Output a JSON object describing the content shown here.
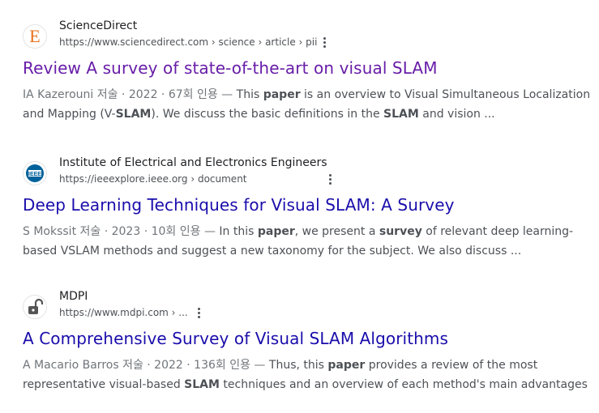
{
  "results": [
    {
      "site_name": "ScienceDirect",
      "url": "https://www.sciencedirect.com › science › article › pii",
      "favicon": "elsevier-e-icon",
      "title": "Review A survey of state-of-the-art on visual SLAM",
      "title_color": "#681da8",
      "snippet_meta": "IA Kazerouni 저술 · 2022 · 67회 인용 — ",
      "snippet_parts": {
        "p1": "This ",
        "b1": "paper",
        "p2": " is an overview to Visual Simultaneous Localization",
        "p3": "and Mapping (V-",
        "b2": "SLAM",
        "p4": "). We discuss the basic definitions in the ",
        "b3": "SLAM",
        "p5": " and vision ..."
      }
    },
    {
      "site_name": "Institute of Electrical and Electronics Engineers",
      "url": "https://ieeexplore.ieee.org › document",
      "favicon": "ieee-icon",
      "title": "Deep Learning Techniques for Visual SLAM: A Survey",
      "title_color": "#1a0dab",
      "snippet_meta": "S Mokssit 저술 · 2023 · 10회 인용 — ",
      "snippet_parts": {
        "p1": "In this ",
        "b1": "paper",
        "p2": ", we present a ",
        "b2": "survey",
        "p3": " of relevant deep learning-",
        "p4": "based VSLAM methods and suggest a new taxonomy for the subject. We also discuss ..."
      }
    },
    {
      "site_name": "MDPI",
      "url": "https://www.mdpi.com › ...",
      "favicon": "open-access-lock-icon",
      "title": "A Comprehensive Survey of Visual SLAM Algorithms",
      "title_color": "#1a0dab",
      "snippet_meta": "A Macario Barros 저술 · 2022 · 136회 인용 — ",
      "snippet_parts": {
        "p1": "Thus, this ",
        "b1": "paper",
        "p2": " provides a review of the most",
        "p3": "representative visual-based ",
        "b2": "SLAM",
        "p4": " techniques and an overview of each method's main advantages a⋯"
      }
    }
  ]
}
